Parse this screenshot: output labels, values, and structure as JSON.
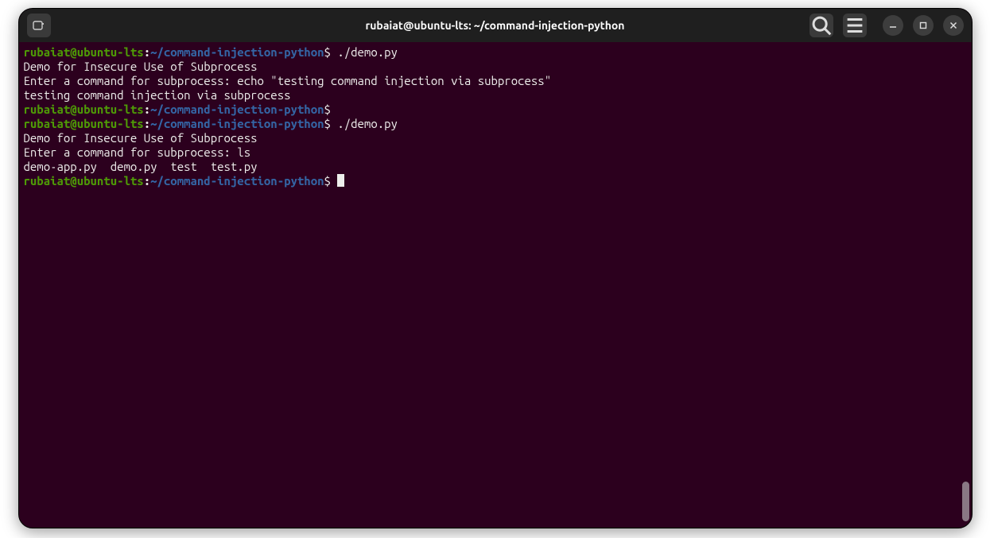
{
  "window": {
    "title": "rubaiat@ubuntu-lts: ~/command-injection-python"
  },
  "prompt": {
    "user_host": "rubaiat@ubuntu-lts",
    "separator": ":",
    "path": "~/command-injection-python",
    "symbol": "$"
  },
  "session": {
    "cmd1": "./demo.py",
    "out1a": "Demo for Insecure Use of Subprocess",
    "out1b": "Enter a command for subprocess: echo \"testing command injection via subprocess\"",
    "out1c": "testing command injection via subprocess",
    "cmd2": "",
    "cmd3": "./demo.py",
    "out3a": "Demo for Insecure Use of Subprocess",
    "out3b": "Enter a command for subprocess: ls",
    "out3c": "demo-app.py  demo.py  test  test.py",
    "cmd4": ""
  },
  "icons": {
    "new_tab": "new-tab",
    "search": "search",
    "menu": "menu",
    "minimize": "minimize",
    "maximize": "maximize",
    "close": "close"
  }
}
